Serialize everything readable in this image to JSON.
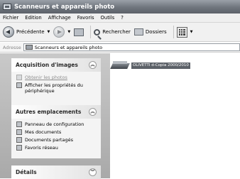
{
  "window": {
    "title": "Scanneurs et appareils photo"
  },
  "menu": [
    "Fichier",
    "Edition",
    "Affichage",
    "Favoris",
    "Outils",
    "?"
  ],
  "toolbar": {
    "back_label": "Précédente",
    "search_label": "Rechercher",
    "folders_label": "Dossiers"
  },
  "address": {
    "label": "Adresse",
    "value": "Scanneurs et appareils photo"
  },
  "taskpane": {
    "acquisition": {
      "title": "Acquisition d'images",
      "items": [
        "Obtenir les photos",
        "Afficher les propriétés du périphérique"
      ]
    },
    "places": {
      "title": "Autres emplacements",
      "items": [
        "Panneau de configuration",
        "Mes documents",
        "Documents partagés",
        "Favoris réseau"
      ]
    },
    "details": {
      "title": "Détails"
    }
  },
  "devices": [
    {
      "name": "OLIVETTI d-Copia 2000/2010",
      "icon": "scanner-icon"
    }
  ]
}
